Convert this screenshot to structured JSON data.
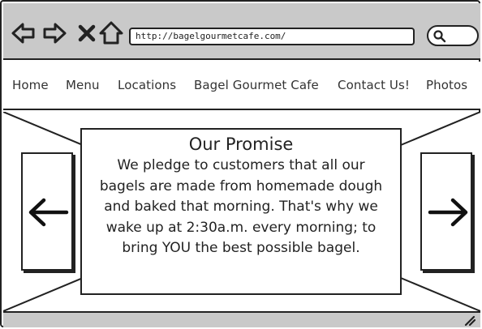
{
  "browser": {
    "url": "http://bagelgourmetcafe.com/",
    "icons": [
      "back-icon",
      "forward-icon",
      "close-icon",
      "home-icon",
      "search-icon"
    ]
  },
  "nav": {
    "items": [
      {
        "label": "Home"
      },
      {
        "label": "Menu"
      },
      {
        "label": "Locations"
      },
      {
        "label": "Bagel Gourmet Cafe"
      },
      {
        "label": "Contact Us!"
      },
      {
        "label": "Photos"
      }
    ]
  },
  "carousel": {
    "title": "Our Promise",
    "body": "We pledge to customers that all our bagels are made from homemade dough and baked that morning. That's why we wake up at 2:30a.m. every morning; to bring YOU the best possible bagel.",
    "prev_icon": "arrow-left-icon",
    "next_icon": "arrow-right-icon"
  },
  "colors": {
    "toolbar_bg": "#c9c9c9",
    "stroke": "#222222",
    "page_bg": "#ffffff"
  }
}
